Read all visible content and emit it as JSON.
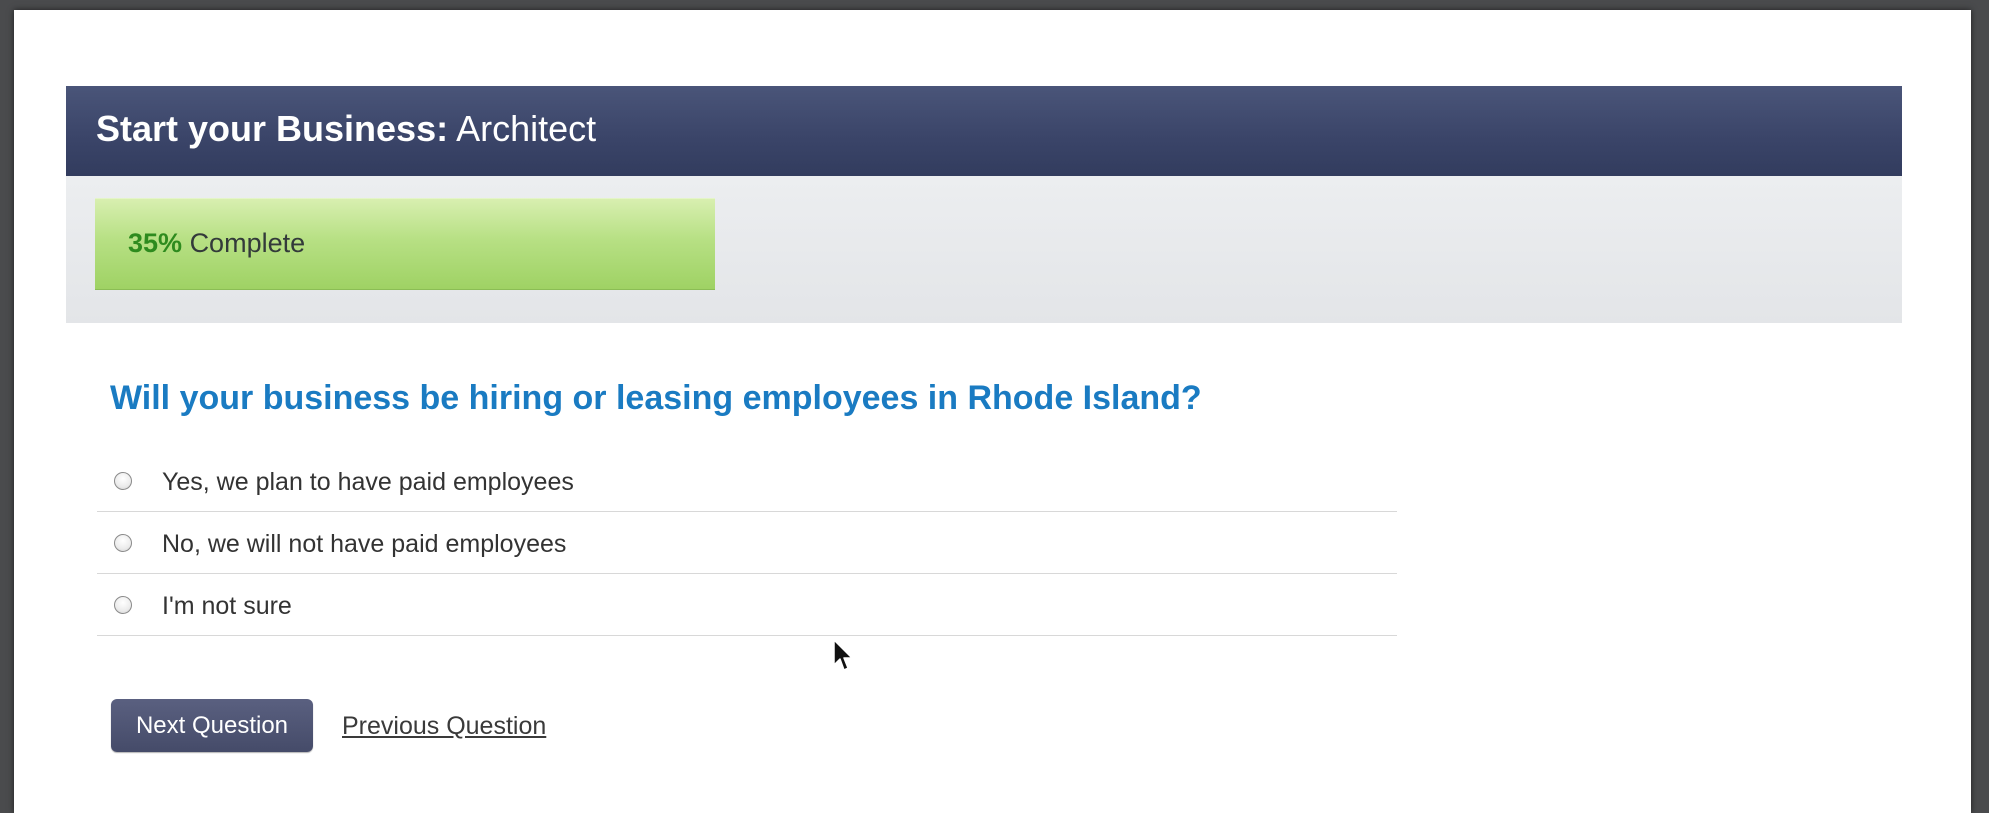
{
  "header": {
    "title_strong": "Start your Business:",
    "title_light": "Architect"
  },
  "progress": {
    "percent_label": "35%",
    "label": "Complete",
    "fraction": 0.35,
    "fill_color": "#a6d66f"
  },
  "question": {
    "text": "Will your business be hiring or leasing employees in Rhode Island?",
    "color": "#1a7bc2"
  },
  "options": [
    {
      "label": "Yes, we plan to have paid employees",
      "selected": false
    },
    {
      "label": "No, we will not have paid employees",
      "selected": false
    },
    {
      "label": "I'm not sure",
      "selected": false
    }
  ],
  "actions": {
    "next_label": "Next Question",
    "previous_label": "Previous Question"
  },
  "colors": {
    "header_bg": "#3a4468",
    "button_bg": "#4e5474"
  },
  "icons": {
    "cursor": "mouse-pointer-icon"
  }
}
